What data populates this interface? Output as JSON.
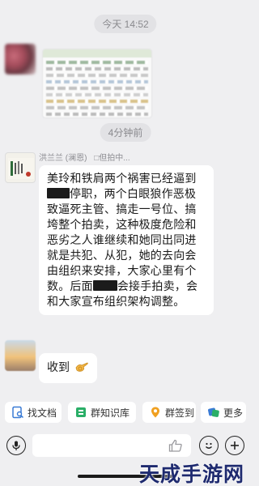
{
  "chat": {
    "timestamp_top": "今天 14:52",
    "timestamp_mid": "4分钟前",
    "sender_name": "洪兰兰 (澜恩)",
    "sender_status": "□但拍中..."
  },
  "messages": {
    "long_text": {
      "line1": "美玲和铁肩两个祸害已经逼到",
      "line2_after_redact": "停职，两个白眼狼作恶极致逼死主管、搞走一号位、搞垮整个拍卖，这种极度危险和恶劣之人谁继续和她同出同进就是共犯、从犯，她的去向会由组织来安排，大家心里有个数。",
      "line3_prefix": "后面",
      "line3_after_redact": "会接手拍卖，会和大家宣布组织架构调整。"
    },
    "reply_text": "收到"
  },
  "toolbar": {
    "items": [
      {
        "label": "找文档",
        "icon": "document-search-icon"
      },
      {
        "label": "群知识库",
        "icon": "knowledge-base-icon"
      },
      {
        "label": "群签到",
        "icon": "location-checkin-icon"
      },
      {
        "label": "更多",
        "icon": "more-icon"
      }
    ]
  },
  "input": {
    "placeholder": ""
  },
  "watermark": "天成手游网",
  "colors": {
    "background": "#efeff1",
    "bubble": "#ffffff",
    "watermark": "#1e2a6f"
  }
}
